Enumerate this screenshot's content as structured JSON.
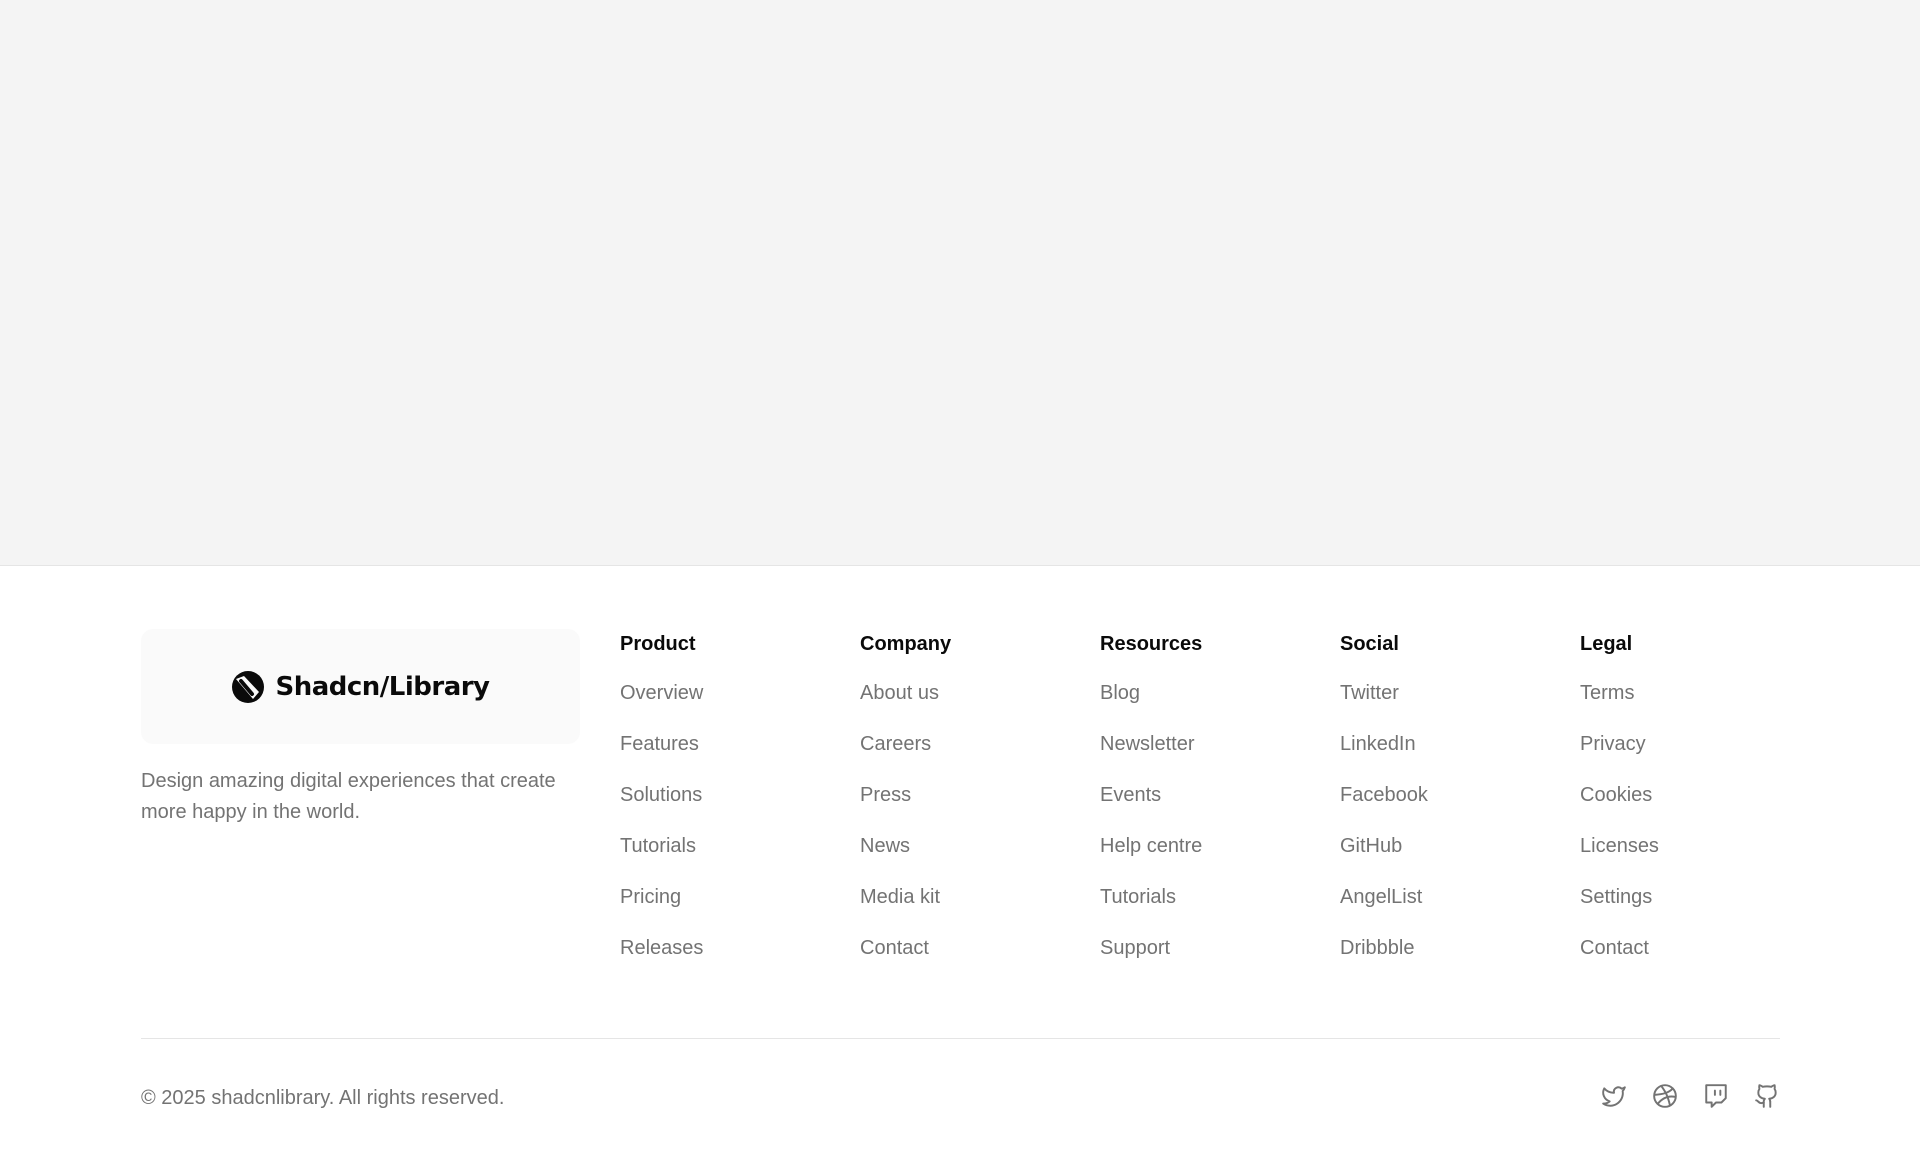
{
  "brand": {
    "logo_text": "Shadcn/Library",
    "tagline": "Design amazing digital experiences that create more happy in the world."
  },
  "columns": [
    {
      "title": "Product",
      "links": [
        "Overview",
        "Features",
        "Solutions",
        "Tutorials",
        "Pricing",
        "Releases"
      ]
    },
    {
      "title": "Company",
      "links": [
        "About us",
        "Careers",
        "Press",
        "News",
        "Media kit",
        "Contact"
      ]
    },
    {
      "title": "Resources",
      "links": [
        "Blog",
        "Newsletter",
        "Events",
        "Help centre",
        "Tutorials",
        "Support"
      ]
    },
    {
      "title": "Social",
      "links": [
        "Twitter",
        "LinkedIn",
        "Facebook",
        "GitHub",
        "AngelList",
        "Dribbble"
      ]
    },
    {
      "title": "Legal",
      "links": [
        "Terms",
        "Privacy",
        "Cookies",
        "Licenses",
        "Settings",
        "Contact"
      ]
    }
  ],
  "bottom": {
    "copyright": "© 2025 shadcnlibrary. All rights reserved.",
    "social_icons": [
      "twitter-icon",
      "dribbble-icon",
      "twitch-icon",
      "github-icon"
    ]
  },
  "colors": {
    "hero_background": "#f4f4f4",
    "heading": "#0a0a0a",
    "muted_text": "#737373",
    "border": "#e5e5e5"
  }
}
